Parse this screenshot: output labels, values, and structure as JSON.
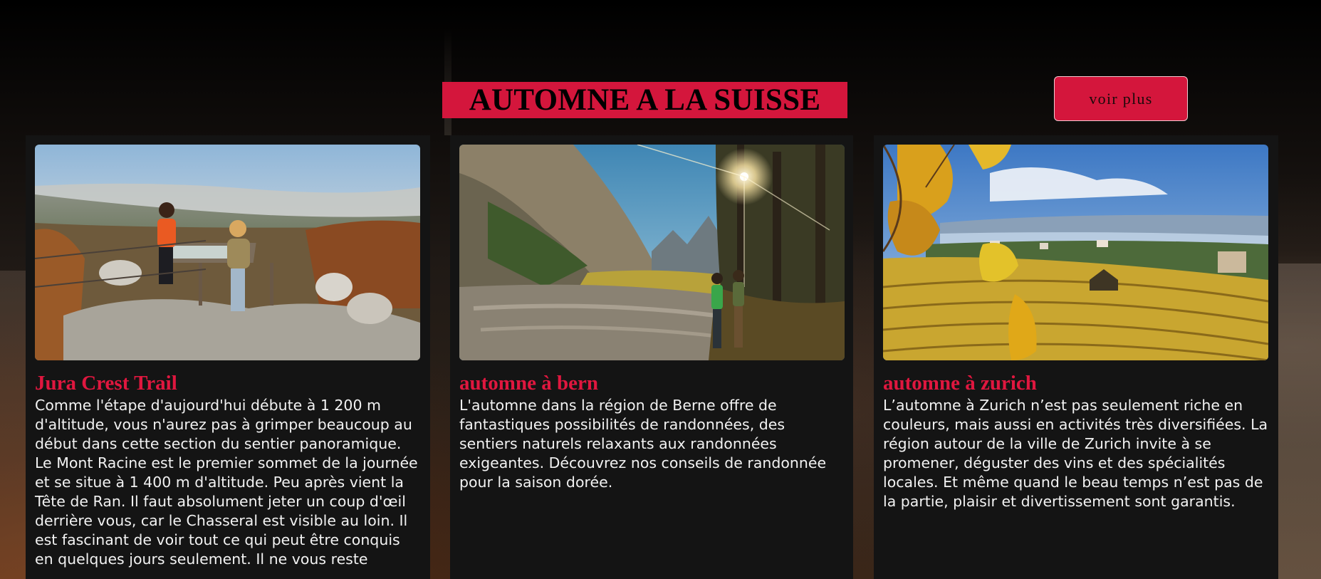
{
  "page": {
    "heading": "AUTOMNE A LA SUISSE",
    "more_button": "voir plus"
  },
  "colors": {
    "accent": "#d4163c",
    "card_background": "#141414",
    "text": "#f2f2f2",
    "title_text": "#000000"
  },
  "cards": [
    {
      "image_alt": "Two hikers looking at a panoramic information board on the Jura crest in autumn",
      "title": "Jura Crest Trail",
      "text": "Comme l'étape d'aujourd'hui débute à 1 200 m d'altitude, vous n'aurez pas à grimper beaucoup au début dans cette section du sentier panoramique. Le Mont Racine est le premier sommet de la journée et se situe à 1 400 m d'altitude. Peu après vient la Tête de Ran. Il faut absolument jeter un coup d'œil derrière vous, car le Chasseral est visible au loin. Il est fascinant de voir tout ce qui peut être conquis en quelques jours seulement. Il ne vous reste"
    },
    {
      "image_alt": "Two hikers on a gravel riverbed below tall cliffs with sun shining through trees",
      "title": "automne à bern",
      "text": "L'automne dans la région de Berne offre de fantastiques possibilités de randonnées, des sentiers naturels relaxants aux randonnées exigeantes. Découvrez nos conseils de randonnée pour la saison dorée."
    },
    {
      "image_alt": "Golden autumn vineyards above a lake near Zurich with yellow leaves in the foreground",
      "title": "automne à zurich",
      "text": "L’automne à Zurich n’est pas seulement riche en couleurs, mais aussi en activités très diversifiées. La région autour de la ville de Zurich invite à se promener, déguster des vins et des spécialités locales. Et même quand le beau temps n’est pas de la partie, plaisir et divertissement sont garantis."
    }
  ]
}
